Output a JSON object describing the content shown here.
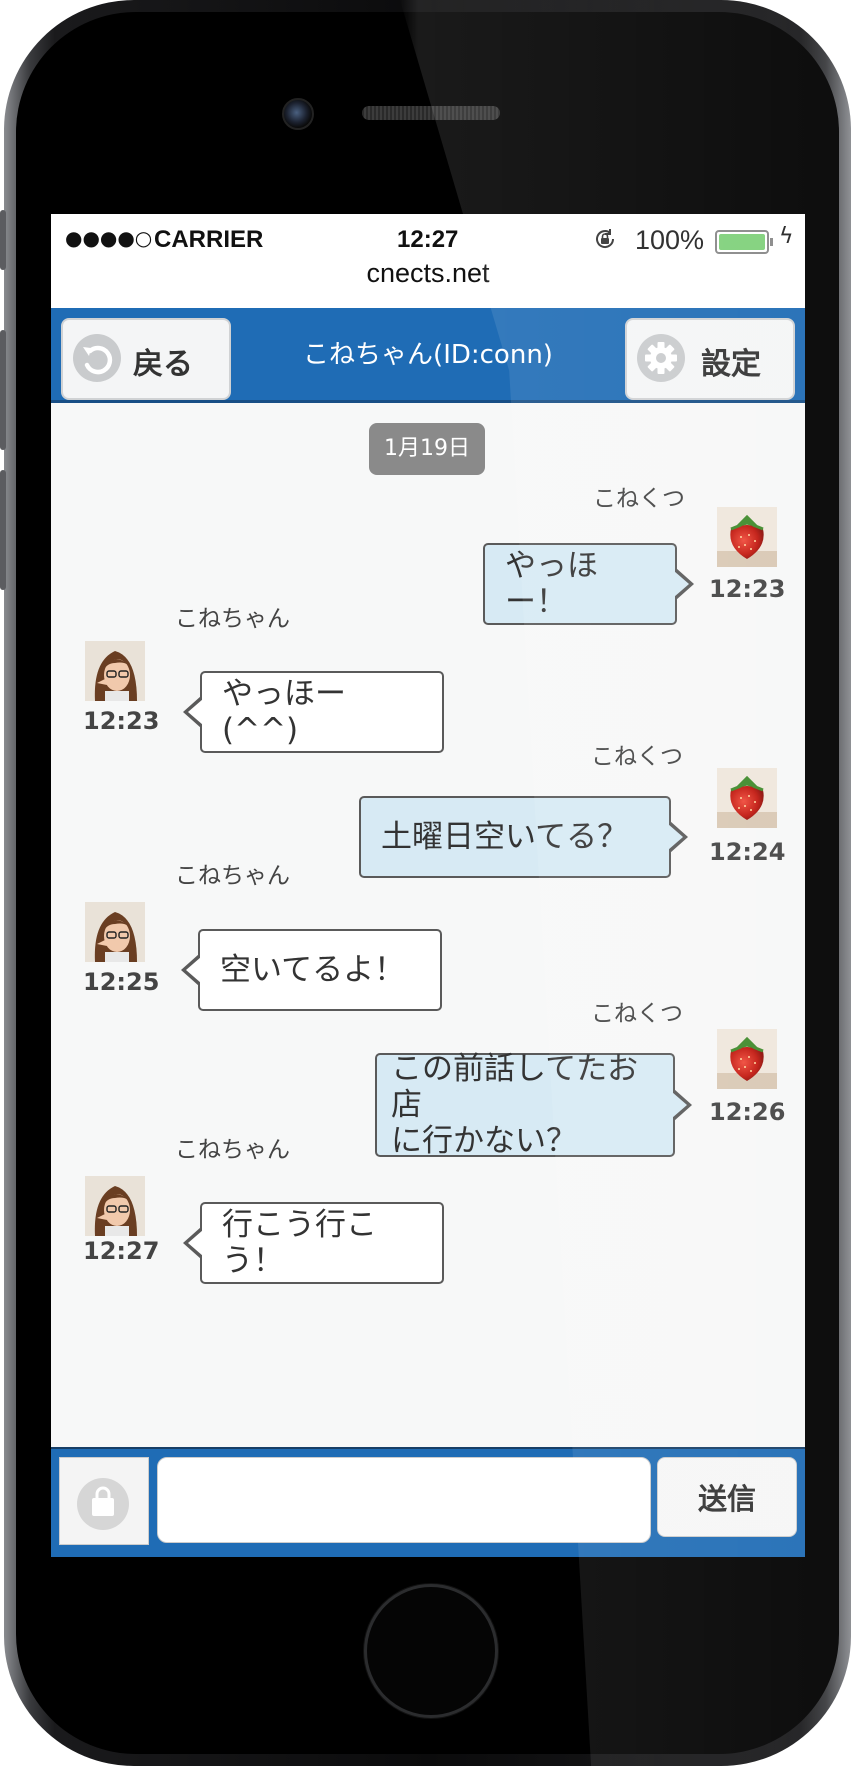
{
  "status_bar": {
    "signal": "●●●●○",
    "carrier": "CARRIER",
    "time": "12:27",
    "battery": "100%"
  },
  "browser": {
    "url": "cnects.net"
  },
  "nav": {
    "back_label": "戻る",
    "title": "こねちゃん(ID:conn)",
    "settings_label": "設定"
  },
  "chat": {
    "date": "1月19日",
    "messages": [
      {
        "from": "me",
        "sender": "こねくつ",
        "text": "やっほー！",
        "time": "12:23"
      },
      {
        "from": "them",
        "sender": "こねちゃん",
        "text": "やっほー(^^)",
        "time": "12:23"
      },
      {
        "from": "me",
        "sender": "こねくつ",
        "text": "土曜日空いてる？",
        "time": "12:24"
      },
      {
        "from": "them",
        "sender": "こねちゃん",
        "text": "空いてるよ！",
        "time": "12:25"
      },
      {
        "from": "me",
        "sender": "こねくつ",
        "text_line1": "この前話してたお店",
        "text_line2": "に行かない？",
        "time": "12:26"
      },
      {
        "from": "them",
        "sender": "こねちゃん",
        "text": "行こう行こう！",
        "time": "12:27"
      }
    ]
  },
  "composer": {
    "input_value": "",
    "send_label": "送信"
  },
  "colors": {
    "navbar": "#1f6cb5",
    "my_bubble": "#d7eaf4",
    "their_bubble": "#ffffff",
    "date_pill": "#8a8a8a"
  }
}
